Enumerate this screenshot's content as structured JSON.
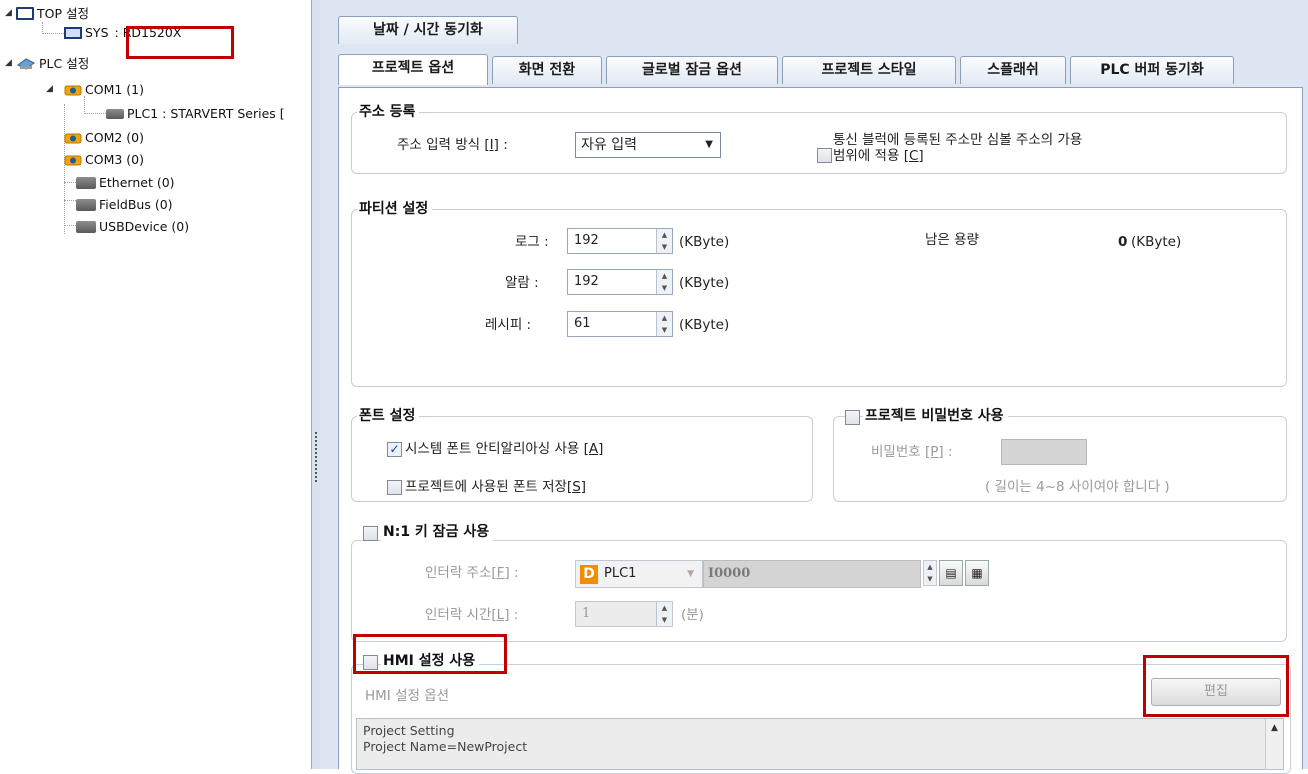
{
  "tree": {
    "top_setting": "TOP 설정",
    "sys_prefix": "SYS",
    "sys_value": ": RD1520X",
    "plc_setting": "PLC 설정",
    "com1": "COM1 (1)",
    "plc1": "PLC1 : STARVERT Series [",
    "com2": "COM2 (0)",
    "com3": "COM3 (0)",
    "ethernet": "Ethernet (0)",
    "fieldbus": "FieldBus (0)",
    "usbdevice": "USBDevice (0)"
  },
  "top_tab": "날짜 / 시간 동기화",
  "tabs": [
    "프로젝트 옵션",
    "화면 전환",
    "글로벌 잠금 옵션",
    "프로젝트 스타일",
    "스플래쉬",
    "PLC 버퍼 동기화"
  ],
  "address": {
    "title": "주소 등록",
    "input_method_label": "주소 입력 방식 ",
    "input_method_key": "[I]",
    "input_method_suffix": " :",
    "input_method_value": "자유 입력",
    "comm_block_line1": "통신 블럭에 등록된 주소만 심볼 주소의 가용",
    "comm_block_line2": "범위에 적용 ",
    "comm_block_key": "[C]",
    "comm_block_checked": false
  },
  "partition": {
    "title": "파티션 설정",
    "log_label": "로그 :",
    "log_value": "192",
    "alarm_label": "알람 :",
    "alarm_value": "192",
    "recipe_label": "레시피 :",
    "recipe_value": "61",
    "unit": "(KByte)",
    "remaining_label": "남은 용량",
    "remaining_value": "0"
  },
  "font": {
    "title": "폰트 설정",
    "antialias_label": "시스템 폰트 안티알리아싱 사용 ",
    "antialias_key": "[A]",
    "antialias_checked": true,
    "save_font_label": "프로젝트에 사용된 폰트 저장",
    "save_font_key": "[S]",
    "save_font_checked": false
  },
  "password": {
    "title": "프로젝트 비밀번호 사용",
    "checked": false,
    "label": "비밀번호 ",
    "key": "[P]",
    "suffix": " :",
    "hint": "( 길이는 4~8 사이여야 합니다 )"
  },
  "n1lock": {
    "title": "N:1 키 잠금 사용",
    "checked": false,
    "interlock_addr_label": "인터락 주소",
    "interlock_addr_key": "[F]",
    "interlock_addr_suffix": " :",
    "device_badge": "D",
    "device": "PLC1",
    "address": "I0000",
    "interlock_time_label": "인터락 시간",
    "interlock_time_key": "[L]",
    "interlock_time_suffix": " :",
    "interlock_time_value": "1",
    "unit": "(분)"
  },
  "hmi": {
    "title": "HMI 설정 사용",
    "checked": false,
    "options_label": "HMI 설정 옵션",
    "edit_button": "편집",
    "text_lines": [
      "Project Setting",
      "Project Name=NewProject"
    ]
  },
  "colors": {
    "highlight_red": "#c00000",
    "panel_bg": "#dde6f2",
    "accent_orange": "#f28c00"
  }
}
